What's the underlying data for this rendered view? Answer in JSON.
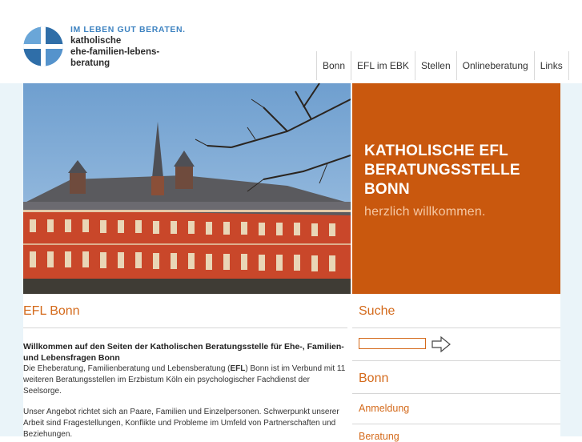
{
  "header": {
    "logo_tagline": "IM LEBEN GUT BERATEN.",
    "logo_line1": "katholische",
    "logo_line2": "ehe-familien-lebens-",
    "logo_line3": "beratung",
    "logo_icon": "cross-circle-logo"
  },
  "nav": {
    "items": [
      {
        "label": "Bonn"
      },
      {
        "label": "EFL im EBK"
      },
      {
        "label": "Stellen"
      },
      {
        "label": "Onlineberatung"
      },
      {
        "label": "Links"
      }
    ]
  },
  "hero": {
    "title_line1": "KATHOLISCHE EFL",
    "title_line2": "BERATUNGSSTELLE",
    "title_line3": "BONN",
    "subtitle": "herzlich willkommen."
  },
  "main": {
    "title": "EFL Bonn",
    "intro_bold": "Willkommen auf den Seiten der Katholischen Beratungsstelle für Ehe-, Familien- und Lebensfragen Bonn",
    "p1_part1": "Die Eheberatung, Familienberatung und Lebensberatung (",
    "p1_bold": "EFL",
    "p1_part2": ") Bonn ist im Verbund mit 11 weiteren Beratungsstellen im Erzbistum Köln ein psychologischer Fachdienst der Seelsorge.",
    "p2": "Unser Angebot richtet sich an Paare, Familien und Einzelpersonen. Schwerpunkt unserer Arbeit sind Fragestellungen, Konflikte und Probleme im Umfeld von Partnerschaften und Beziehungen."
  },
  "sidebar": {
    "search_title": "Suche",
    "search_value": "",
    "search_button_icon": "arrow-right-icon",
    "section_title": "Bonn",
    "links": [
      {
        "label": "Anmeldung"
      },
      {
        "label": "Beratung"
      }
    ]
  },
  "colors": {
    "accent": "#d46a1b",
    "hero_panel": "#c9580e",
    "logo_blue": "#3e83c1",
    "side_band": "#eaf4f9"
  }
}
